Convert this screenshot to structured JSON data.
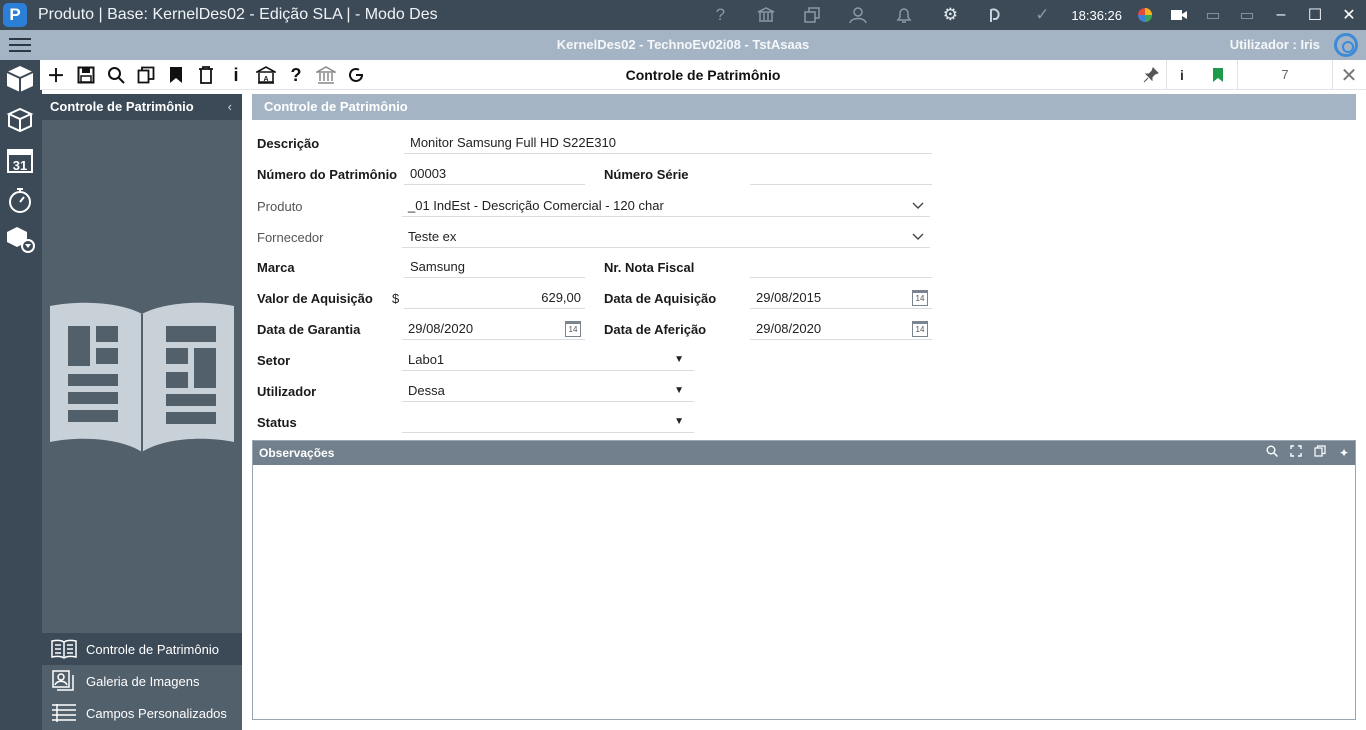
{
  "titlebar": {
    "title": "Produto | Base: KernelDes02 - Edição SLA | - Modo Des",
    "clock": "18:36:26",
    "icons": [
      "help-icon",
      "bank-icon",
      "windows-icon",
      "user-icon",
      "bell-icon",
      "gear-icon",
      "chat-icon",
      "check-icon"
    ],
    "window_controls": [
      "minimize",
      "maximize",
      "close"
    ]
  },
  "infobar": {
    "context": "KernelDes02 - TechnoEv02i08 - TstAsaas",
    "user": "Utilizador : Iris"
  },
  "toolbar": {
    "title": "Controle de Patrimônio",
    "record_count": "7",
    "tools": [
      "add-icon",
      "save-icon",
      "search-icon",
      "copy-icon",
      "bookmark-icon",
      "delete-icon",
      "info-icon",
      "institution-icon",
      "help-icon",
      "bank-icon",
      "refresh-icon"
    ],
    "right_tools": [
      "pin-icon",
      "info-icon",
      "bookmark-green-icon"
    ],
    "info_label": "i"
  },
  "rail": {
    "items": [
      "cube-icon",
      "stack-icon",
      "calendar-icon",
      "stopwatch-icon",
      "cube-filter-icon"
    ],
    "calendar_day": "31"
  },
  "sidepanel": {
    "title": "Controle de Patrimônio",
    "nav": [
      {
        "label": "Controle de Patrimônio",
        "icon": "book-icon",
        "active": true
      },
      {
        "label": "Galeria de Imagens",
        "icon": "images-icon",
        "active": false
      },
      {
        "label": "Campos Personalizados",
        "icon": "list-icon",
        "active": false
      }
    ]
  },
  "form": {
    "section_title": "Controle de Patrimônio",
    "descricao_label": "Descrição",
    "descricao_value": "Monitor Samsung Full HD S22E310",
    "numero_label": "Número do Patrimônio",
    "numero_value": "00003",
    "serie_label": "Número Série",
    "serie_value": "",
    "produto_label": "Produto",
    "produto_value": "_01 IndEst - Descrição Comercial - 120 char",
    "fornecedor_label": "Fornecedor",
    "fornecedor_value": "Teste ex",
    "marca_label": "Marca",
    "marca_value": "Samsung",
    "nota_label": "Nr. Nota Fiscal",
    "nota_value": "",
    "valor_label": "Valor de Aquisição",
    "currency": "$",
    "valor_value": "629,00",
    "data_aquisicao_label": "Data de Aquisição",
    "data_aquisicao_value": "29/08/2015",
    "garantia_label": "Data de Garantia",
    "garantia_value": "29/08/2020",
    "afericao_label": "Data de Aferição",
    "afericao_value": "29/08/2020",
    "setor_label": "Setor",
    "setor_value": "Labo1",
    "utilizador_label": "Utilizador",
    "utilizador_value": "Dessa",
    "status_label": "Status",
    "status_value": "",
    "calendar_day": "14"
  },
  "observacoes": {
    "title": "Observações",
    "tools": [
      "search-icon",
      "expand-icon",
      "copy-icon",
      "sparkle-icon"
    ]
  },
  "colors": {
    "dark": "#3c4a57",
    "light_bar": "#a4b4c4",
    "panel": "#52606c",
    "accent_blue": "#2b7fd6",
    "bookmark_green": "#1f9a4a"
  }
}
